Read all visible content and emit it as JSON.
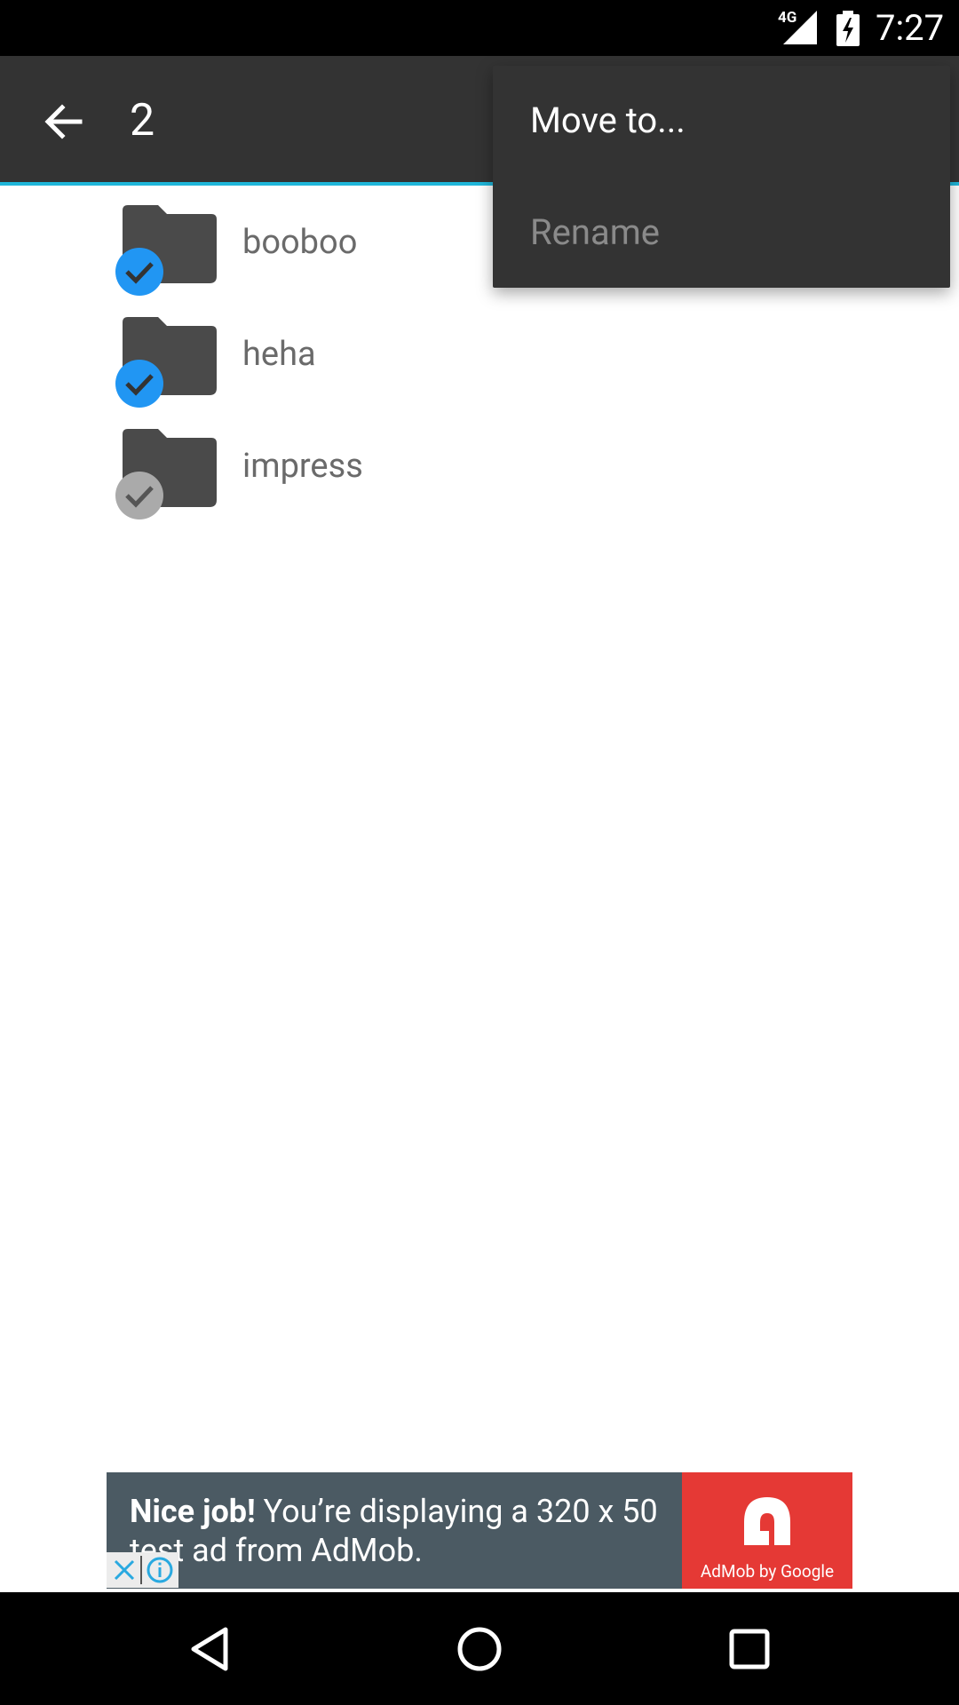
{
  "status_bar": {
    "network": "4G",
    "time": "7:27",
    "icons": [
      "signal-icon",
      "battery-charging-icon"
    ]
  },
  "toolbar": {
    "selected_count": "2",
    "accent_color": "#1fb6d9"
  },
  "folders": [
    {
      "name": "booboo",
      "checked": true
    },
    {
      "name": "heha",
      "checked": true
    },
    {
      "name": "impress",
      "checked": false
    }
  ],
  "menu": {
    "items": [
      {
        "label": "Move to...",
        "enabled": true
      },
      {
        "label": "Rename",
        "enabled": false
      }
    ]
  },
  "ad": {
    "bold": "Nice job!",
    "text": " You’re displaying a 320 x 50 test ad from AdMob.",
    "logo_text": "AdMob by Google",
    "brand_color": "#e53935"
  },
  "navbar": {
    "buttons": [
      "back-icon",
      "home-icon",
      "recents-icon"
    ]
  }
}
